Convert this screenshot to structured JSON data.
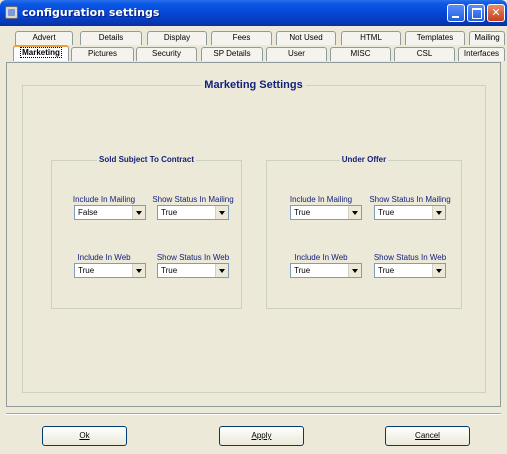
{
  "window": {
    "title": "configuration settings"
  },
  "tabs_row1": [
    "Advert",
    "Details",
    "Display",
    "Fees",
    "Not Used",
    "HTML",
    "Templates",
    "Mailing"
  ],
  "tabs_row2": [
    "Marketing",
    "Pictures",
    "Security",
    "SP Details",
    "User",
    "MISC",
    "CSL",
    "Interfaces"
  ],
  "active_tab": "Marketing",
  "section_title": "Marketing Settings",
  "groups": {
    "sold": {
      "title": "Sold Subject To Contract",
      "include_mailing_label": "Include In Mailing",
      "include_mailing_value": "False",
      "show_status_mailing_label": "Show Status In Mailing",
      "show_status_mailing_value": "True",
      "include_web_label": "Include In Web",
      "include_web_value": "True",
      "show_status_web_label": "Show Status In Web",
      "show_status_web_value": "True"
    },
    "offer": {
      "title": "Under Offer",
      "include_mailing_label": "Include In Mailing",
      "include_mailing_value": "True",
      "show_status_mailing_label": "Show Status In Mailing",
      "show_status_mailing_value": "True",
      "include_web_label": "Include In Web",
      "include_web_value": "True",
      "show_status_web_label": "Show Status In Web",
      "show_status_web_value": "True"
    }
  },
  "buttons": {
    "ok": "Ok",
    "apply": "Apply",
    "cancel": "Cancel"
  },
  "colors": {
    "accent": "#0544d2",
    "label": "#14227a",
    "tab_highlight": "#f0a030"
  }
}
